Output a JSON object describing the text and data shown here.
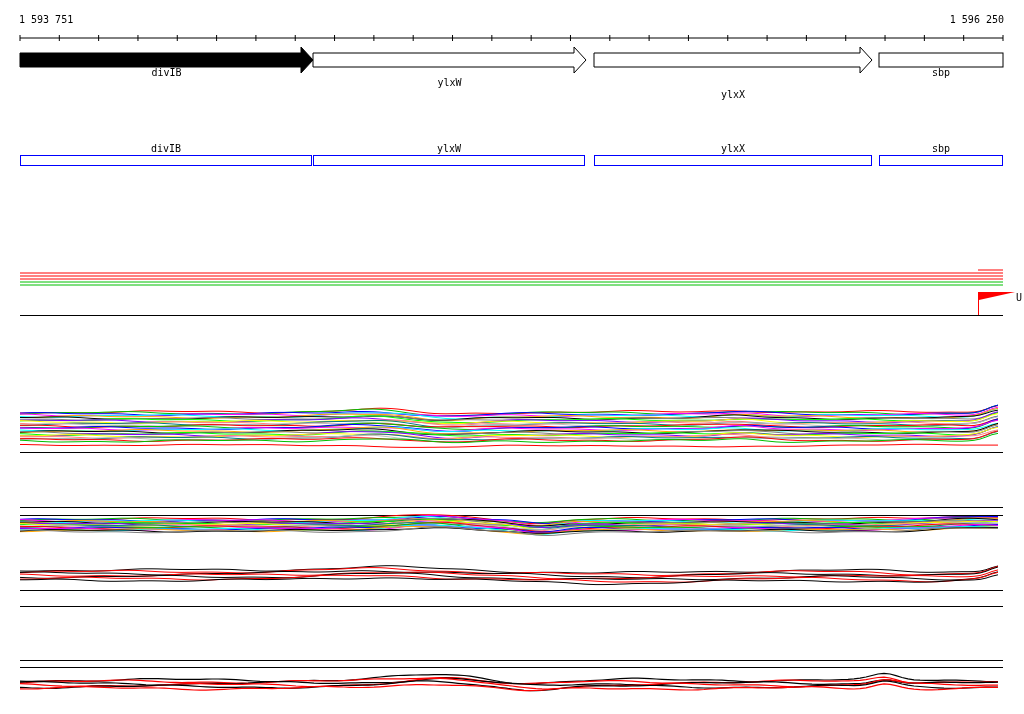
{
  "ruler": {
    "start": "1 593 751",
    "end": "1 596 250"
  },
  "genes": [
    {
      "name": "divIB",
      "kind": "filled-arrow"
    },
    {
      "name": "ylxW",
      "kind": "open-arrow"
    },
    {
      "name": "ylxX",
      "kind": "open-arrow"
    },
    {
      "name": "sbp",
      "kind": "box"
    }
  ],
  "gene_boxes": [
    {
      "name": "divIB"
    },
    {
      "name": "ylxW"
    },
    {
      "name": "ylxX"
    },
    {
      "name": "sbp"
    }
  ],
  "marker_label": "U"
}
